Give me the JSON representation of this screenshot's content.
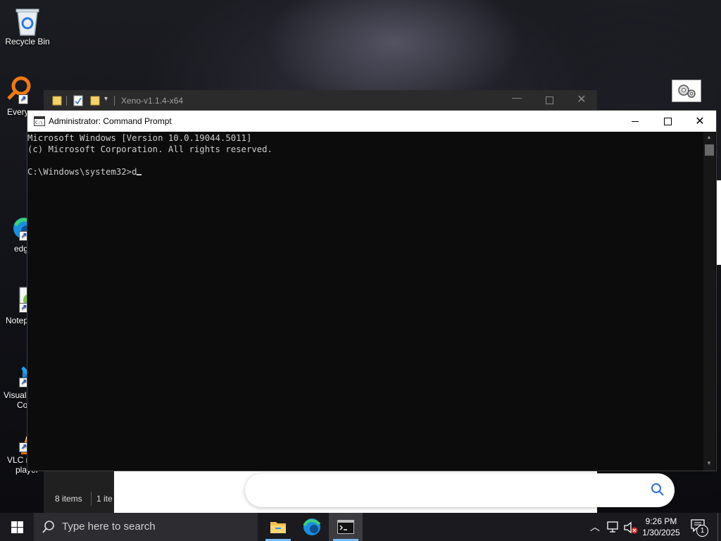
{
  "desktop": {
    "icons": [
      {
        "label": "Recycle Bin",
        "icon": "recycle-bin-icon"
      },
      {
        "label": "Every",
        "icon": "everything-search-icon"
      },
      {
        "label": "edg",
        "icon": "edge-icon"
      },
      {
        "label": "Notep",
        "icon": "notepad-plus-plus-icon"
      },
      {
        "label": "Visual",
        "label2": "Co",
        "icon": "vscode-icon"
      },
      {
        "label": "VLC m",
        "label2": "player",
        "icon": "vlc-icon"
      }
    ]
  },
  "explorer": {
    "title": "Xeno-v1.1.4-x64",
    "status_items": "8 items",
    "status_selected": "1 ite"
  },
  "cmd": {
    "title": "Administrator: Command Prompt",
    "lines": [
      "Microsoft Windows [Version 10.0.19044.5011]",
      "(c) Microsoft Corporation. All rights reserved.",
      "",
      "C:\\Windows\\system32>d"
    ]
  },
  "taskbar": {
    "search_placeholder": "Type here to search",
    "apps": [
      "file-explorer-icon",
      "edge-icon",
      "command-prompt-icon"
    ],
    "clock_time": "9:26 PM",
    "clock_date": "1/30/2025",
    "notification_count": "1"
  },
  "colors": {
    "cmd_bg": "#0c0c0c",
    "cmd_text": "#cccccc",
    "taskbar_bg": "#1a1a1f",
    "accent_blue": "#0078d7"
  }
}
